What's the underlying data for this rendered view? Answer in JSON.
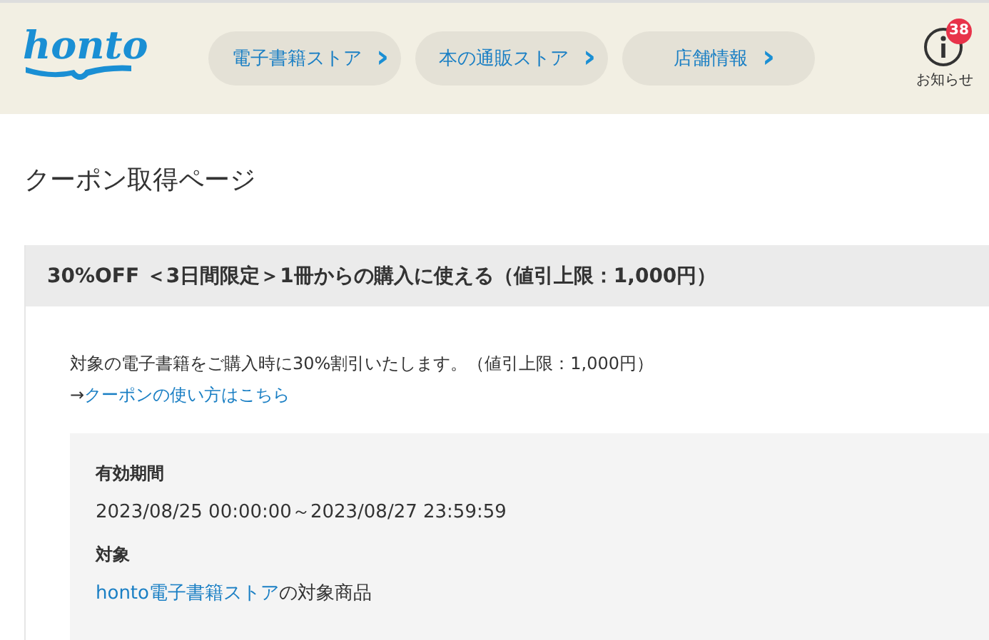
{
  "header": {
    "logo": "honto",
    "nav": [
      {
        "label": "電子書籍ストア",
        "arrow": "›"
      },
      {
        "label": "本の通販ストア",
        "arrow": "›"
      },
      {
        "label": "店舗情報",
        "arrow": "›"
      }
    ],
    "notification": {
      "badge": "38",
      "label": "お知らせ"
    }
  },
  "page_title": "クーポン取得ページ",
  "coupon": {
    "title": "30%OFF ＜3日間限定＞1冊からの購入に使える（値引上限：1,000円）",
    "description": "対象の電子書籍をご購入時に30%割引いたします。（値引上限：1,000円）",
    "link_prefix": "→",
    "link": "クーポンの使い方はこちら",
    "details": [
      {
        "label": "有効期間",
        "kind": "text",
        "value": "2023/08/25 00:00:00～2023/08/27 23:59:59"
      },
      {
        "label": "対象",
        "kind": "link_text",
        "link": "honto電子書籍ストア",
        "value": "の対象商品"
      }
    ]
  }
}
